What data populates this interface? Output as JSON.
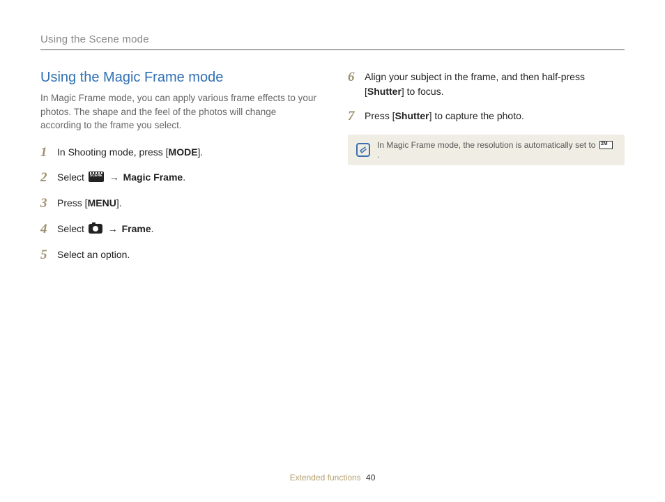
{
  "header": {
    "breadcrumb": "Using the Scene mode"
  },
  "section": {
    "title": "Using the Magic Frame mode",
    "intro": "In Magic Frame mode, you can apply various frame effects to your photos. The shape and the feel of the photos will change according to the frame you select."
  },
  "steps": {
    "s1": {
      "num": "1",
      "pre": "In Shooting mode, press [",
      "label": "MODE",
      "post": "]."
    },
    "s2": {
      "num": "2",
      "pre": "Select ",
      "arrow": " → ",
      "label": "Magic Frame",
      "post": "."
    },
    "s3": {
      "num": "3",
      "pre": "Press [",
      "label": "MENU",
      "post": "]."
    },
    "s4": {
      "num": "4",
      "pre": "Select ",
      "arrow": " → ",
      "label": "Frame",
      "post": "."
    },
    "s5": {
      "num": "5",
      "text": "Select an option."
    },
    "s6": {
      "num": "6",
      "pre": "Align your subject in the frame, and then half-press [",
      "label": "Shutter",
      "post": "] to focus."
    },
    "s7": {
      "num": "7",
      "pre": "Press [",
      "label": "Shutter",
      "post": "] to capture the photo."
    }
  },
  "note": {
    "text_pre": "In Magic Frame mode, the resolution is automatically set to ",
    "text_post": "."
  },
  "footer": {
    "section": "Extended functions",
    "page": "40"
  }
}
